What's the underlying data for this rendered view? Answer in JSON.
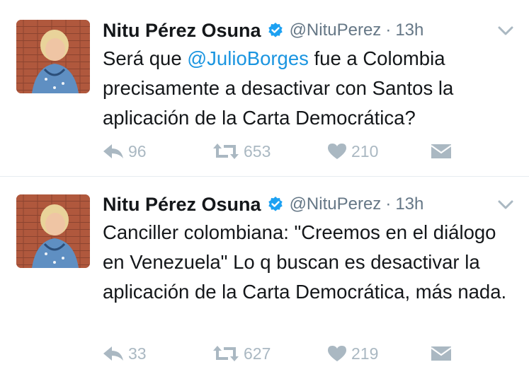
{
  "tweets": [
    {
      "author_name": "Nitu Pérez Osuna",
      "handle": "@NituPerez",
      "separator": "·",
      "time": "13h",
      "text_prefix": "Será que ",
      "mention": "@JulioBorges",
      "text_suffix": " fue a Colombia precisamente a desactivar con Santos la aplicación de la Carta Democrática?",
      "replies": "96",
      "retweets": "653",
      "likes": "210",
      "icons": {
        "reply": "reply-icon",
        "retweet": "retweet-icon",
        "like": "heart-icon",
        "dm": "envelope-icon",
        "caret": "chevron-down-icon",
        "verified": "verified-badge-icon"
      }
    },
    {
      "author_name": "Nitu Pérez Osuna",
      "handle": "@NituPerez",
      "separator": "·",
      "time": "13h",
      "text": "Canciller colombiana: \"Creemos en el diálogo en Venezuela\" Lo q buscan es desactivar la aplicación de la Carta Democrática, más nada.",
      "replies": "33",
      "retweets": "627",
      "likes": "219",
      "icons": {
        "reply": "reply-icon",
        "retweet": "retweet-icon",
        "like": "heart-icon",
        "dm": "envelope-icon",
        "caret": "chevron-down-icon",
        "verified": "verified-badge-icon"
      }
    }
  ],
  "colors": {
    "text": "#14171a",
    "secondary": "#657786",
    "action": "#aab8c2",
    "link": "#1b95e0",
    "verified": "#1da1f2",
    "divider": "#e6ecf0"
  }
}
